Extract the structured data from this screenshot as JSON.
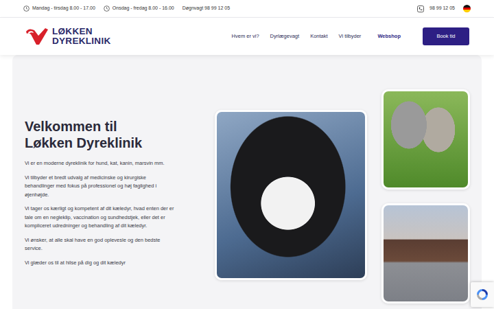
{
  "topbar": {
    "hours": [
      {
        "text": "Mandag - tirsdag 8.00 - 17.00"
      },
      {
        "text": "Onsdag - fredag 8.00 - 16.00"
      }
    ],
    "emergency": "Døgnvagt 98 99 12 05",
    "phone": "98 99 12 05"
  },
  "logo": {
    "line1": "LØKKEN",
    "line2": "DYREKLINIK"
  },
  "nav": {
    "links": [
      {
        "label": "Hvem er vi?",
        "kind": "link"
      },
      {
        "label": "Dyrlægevagt",
        "kind": "link"
      },
      {
        "label": "Kontakt",
        "kind": "link"
      },
      {
        "label": "Vi tilbyder",
        "kind": "link"
      },
      {
        "label": "Webshop",
        "kind": "shop"
      }
    ],
    "button": "Book tid"
  },
  "hero": {
    "title_lines": [
      "Velkommen til",
      "Løkken Dyreklinik"
    ],
    "paragraphs": [
      "Vi er en moderne dyreklinik for hund, kat, kanin, marsvin mm.",
      "Vi tilbyder et bredt udvalg af medicinske og kirurgiske behandlinger med fokus på professionel og høj faglighed i øjenhøjde.",
      "Vi tager os kærligt og kompetent af dit kæledyr, hvad enten der er tale om en negleklip, vaccination og sundhedstjek, eller det er kompliceret udredninger og behandling af dit kæledyr.",
      "Vi ønsker, at alle skal have en god oplevesle og den bedste service.",
      "Vi glæder os til at hilse på dig og dit kæledyr"
    ]
  }
}
